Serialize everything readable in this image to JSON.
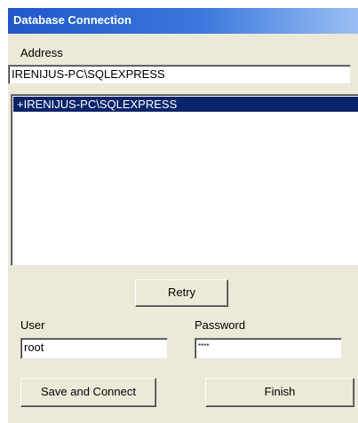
{
  "window": {
    "title": "Database Connection"
  },
  "address": {
    "label": "Address",
    "value": "IRENIJUS-PC\\SQLEXPRESS"
  },
  "servers": {
    "items": [
      "+IRENIJUS-PC\\SQLEXPRESS"
    ],
    "selected_index": 0
  },
  "buttons": {
    "retry": "Retry",
    "save_connect": "Save and Connect",
    "finish": "Finish"
  },
  "user": {
    "label": "User",
    "value": "root"
  },
  "password": {
    "label": "Password",
    "masked_value": "****"
  },
  "colors": {
    "title_bar": "#2058c8",
    "selection": "#0a246a",
    "dialog_bg": "#ece9d8"
  }
}
